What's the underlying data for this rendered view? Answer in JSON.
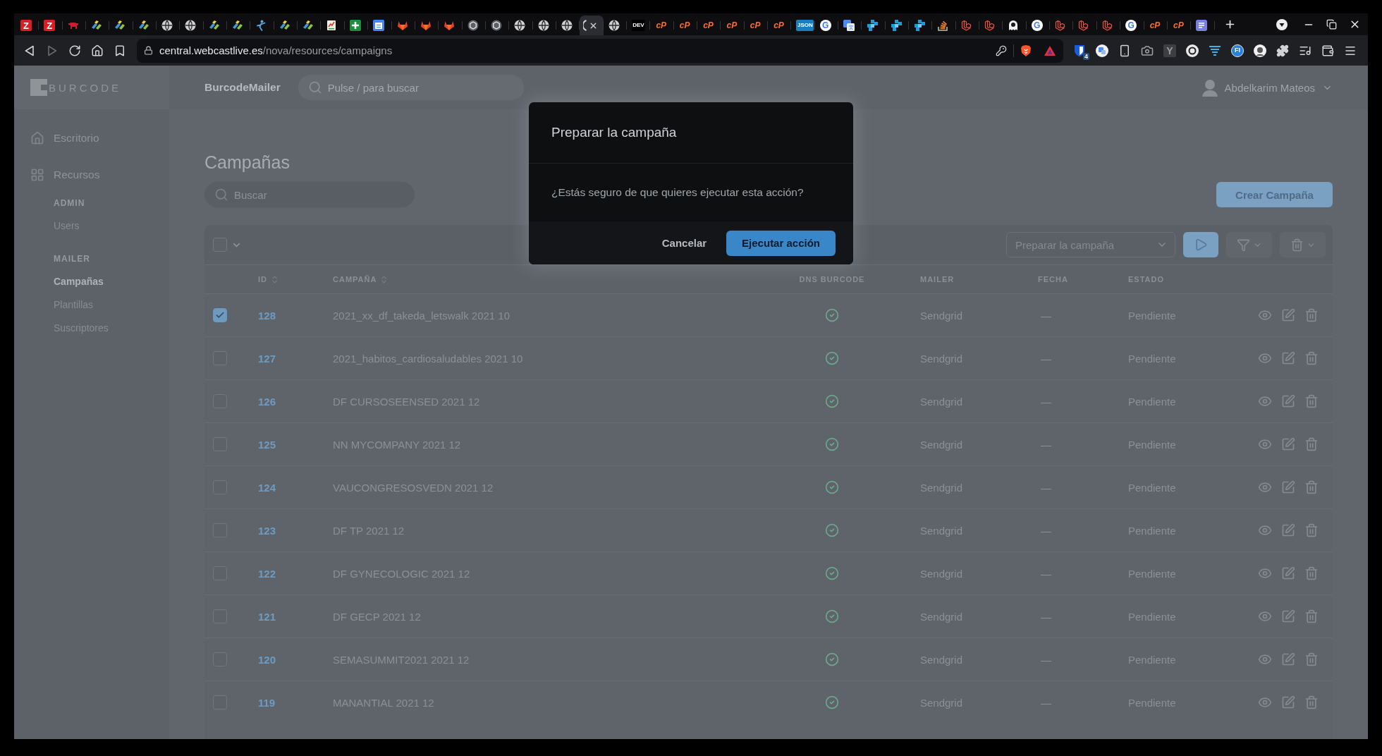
{
  "browser": {
    "tabs": [
      {
        "kind": "red-tile",
        "icon_text": "Z",
        "selected": false
      },
      {
        "kind": "red-tile",
        "icon_text": "Z",
        "selected": false
      },
      {
        "kind": "animal",
        "selected": false
      },
      {
        "kind": "bars",
        "selected": false
      },
      {
        "kind": "bars",
        "selected": false
      },
      {
        "kind": "bars",
        "selected": false
      },
      {
        "kind": "globe",
        "selected": false
      },
      {
        "kind": "globe",
        "selected": false
      },
      {
        "kind": "bars",
        "selected": false
      },
      {
        "kind": "bars",
        "selected": false
      },
      {
        "kind": "figure",
        "selected": false
      },
      {
        "kind": "bars",
        "selected": false
      },
      {
        "kind": "bars",
        "selected": false
      },
      {
        "kind": "sheet",
        "selected": false
      },
      {
        "kind": "plus-tile",
        "selected": false
      },
      {
        "kind": "calendar",
        "selected": false
      },
      {
        "kind": "fox",
        "selected": false
      },
      {
        "kind": "fox",
        "selected": false
      },
      {
        "kind": "fox",
        "selected": false
      },
      {
        "kind": "hexagon",
        "selected": false
      },
      {
        "kind": "hexagon",
        "selected": false
      },
      {
        "kind": "globe",
        "selected": false
      },
      {
        "kind": "globe",
        "selected": false
      },
      {
        "kind": "globe",
        "selected": false
      },
      {
        "kind": "arc",
        "selected": true
      },
      {
        "kind": "globe",
        "selected": false
      },
      {
        "kind": "dark-tile",
        "icon_text": "DEV",
        "selected": false
      },
      {
        "kind": "orange-text",
        "icon_text": "cP",
        "selected": false
      },
      {
        "kind": "orange-text",
        "icon_text": "cP",
        "selected": false
      },
      {
        "kind": "orange-text",
        "icon_text": "cP",
        "selected": false
      },
      {
        "kind": "orange-text",
        "icon_text": "cP",
        "selected": false
      },
      {
        "kind": "orange-text",
        "icon_text": "cP",
        "selected": false
      },
      {
        "kind": "orange-text",
        "icon_text": "cP",
        "selected": false
      },
      {
        "kind": "blue-tile",
        "icon_text": "JSON",
        "selected": false
      },
      {
        "kind": "round-tile",
        "icon_text": "G",
        "selected": false
      },
      {
        "kind": "translate",
        "selected": false
      },
      {
        "kind": "squares",
        "selected": false
      },
      {
        "kind": "squares",
        "selected": false
      },
      {
        "kind": "squares",
        "selected": false
      },
      {
        "kind": "stack",
        "selected": false
      },
      {
        "kind": "cube",
        "selected": false
      },
      {
        "kind": "cube",
        "selected": false
      },
      {
        "kind": "ghost",
        "selected": false
      },
      {
        "kind": "round-tile",
        "icon_text": "G",
        "selected": false
      },
      {
        "kind": "cube",
        "selected": false
      },
      {
        "kind": "cube",
        "selected": false
      },
      {
        "kind": "cube",
        "selected": false
      },
      {
        "kind": "round-tile",
        "icon_text": "G",
        "selected": false
      },
      {
        "kind": "orange-text",
        "icon_text": "cP",
        "selected": false
      },
      {
        "kind": "orange-text",
        "icon_text": "cP",
        "selected": false
      },
      {
        "kind": "chat",
        "selected": false
      }
    ],
    "navigation": {
      "back_disabled": false,
      "forward_disabled": true
    },
    "address_bar": {
      "host": "central.webcastlive.es",
      "path": "/nova/resources/campaigns"
    },
    "extensions": [
      {
        "kind": "shield",
        "badge": "4"
      },
      {
        "kind": "translate"
      },
      {
        "kind": "phone"
      },
      {
        "kind": "camera"
      },
      {
        "kind": "letter-box",
        "icon_text": "Y"
      },
      {
        "kind": "ring"
      },
      {
        "kind": "lines"
      },
      {
        "kind": "letter-circle",
        "icon_text": "FI"
      },
      {
        "kind": "face"
      },
      {
        "kind": "puzzle"
      },
      {
        "kind": "playlist"
      },
      {
        "kind": "wallet"
      }
    ]
  },
  "app": {
    "logo": "BURCODE",
    "header": {
      "title": "BurcodeMailer",
      "search_placeholder": "Pulse / para buscar",
      "user_name": "Abdelkarim Mateos"
    },
    "sidebar": {
      "items": [
        {
          "kind": "home",
          "label": "Escritorio",
          "selected": false
        },
        {
          "kind": "grid",
          "label": "Recursos",
          "selected": false
        }
      ],
      "groups": [
        {
          "heading": "ADMIN",
          "items": [
            {
              "label": "Users",
              "selected": false
            }
          ]
        },
        {
          "heading": "MAILER",
          "items": [
            {
              "label": "Campañas",
              "selected": true
            },
            {
              "label": "Plantillas",
              "selected": false
            },
            {
              "label": "Suscriptores",
              "selected": false
            }
          ]
        }
      ]
    },
    "content": {
      "title": "Campañas",
      "search_placeholder": "Buscar",
      "create_button": "Crear Campaña",
      "table": {
        "select_all": {
          "checked": false
        },
        "action_select": {
          "value": "Preparar la campaña"
        },
        "columns": [
          {
            "label": "ID",
            "sortable": true
          },
          {
            "label": "CAMPAÑA",
            "sortable": true
          },
          {
            "label": "DNS BURCODE",
            "sortable": false
          },
          {
            "label": "MAILER",
            "sortable": false
          },
          {
            "label": "FECHA",
            "sortable": false
          },
          {
            "label": "ESTADO",
            "sortable": false
          }
        ],
        "rows": [
          {
            "selected": true,
            "id": "128",
            "campaign": "2021_xx_df_takeda_letswalk 2021 10",
            "dns_verified": true,
            "mailer": "Sendgrid",
            "date": "—",
            "status": "Pendiente"
          },
          {
            "selected": false,
            "id": "127",
            "campaign": "2021_habitos_cardiosaludables 2021 10",
            "dns_verified": true,
            "mailer": "Sendgrid",
            "date": "—",
            "status": "Pendiente"
          },
          {
            "selected": false,
            "id": "126",
            "campaign": "DF CURSOSEENSED 2021 12",
            "dns_verified": true,
            "mailer": "Sendgrid",
            "date": "—",
            "status": "Pendiente"
          },
          {
            "selected": false,
            "id": "125",
            "campaign": "NN MYCOMPANY 2021 12",
            "dns_verified": true,
            "mailer": "Sendgrid",
            "date": "—",
            "status": "Pendiente"
          },
          {
            "selected": false,
            "id": "124",
            "campaign": "VAUCONGRESOSVEDN 2021 12",
            "dns_verified": true,
            "mailer": "Sendgrid",
            "date": "—",
            "status": "Pendiente"
          },
          {
            "selected": false,
            "id": "123",
            "campaign": "DF TP 2021 12",
            "dns_verified": true,
            "mailer": "Sendgrid",
            "date": "—",
            "status": "Pendiente"
          },
          {
            "selected": false,
            "id": "122",
            "campaign": "DF GYNECOLOGIC 2021 12",
            "dns_verified": true,
            "mailer": "Sendgrid",
            "date": "—",
            "status": "Pendiente"
          },
          {
            "selected": false,
            "id": "121",
            "campaign": "DF GECP 2021 12",
            "dns_verified": true,
            "mailer": "Sendgrid",
            "date": "—",
            "status": "Pendiente"
          },
          {
            "selected": false,
            "id": "120",
            "campaign": "SEMASUMMIT2021 2021 12",
            "dns_verified": true,
            "mailer": "Sendgrid",
            "date": "—",
            "status": "Pendiente"
          },
          {
            "selected": false,
            "id": "119",
            "campaign": "MANANTIAL 2021 12",
            "dns_verified": true,
            "mailer": "Sendgrid",
            "date": "—",
            "status": "Pendiente"
          }
        ]
      }
    }
  },
  "dialog": {
    "title": "Preparar la campaña",
    "message": "¿Estás seguro de que quieres ejecutar esta acción?",
    "buttons": [
      {
        "kind": "secondary",
        "label": "Cancelar"
      },
      {
        "kind": "primary",
        "label": "Ejecutar acción"
      }
    ]
  }
}
